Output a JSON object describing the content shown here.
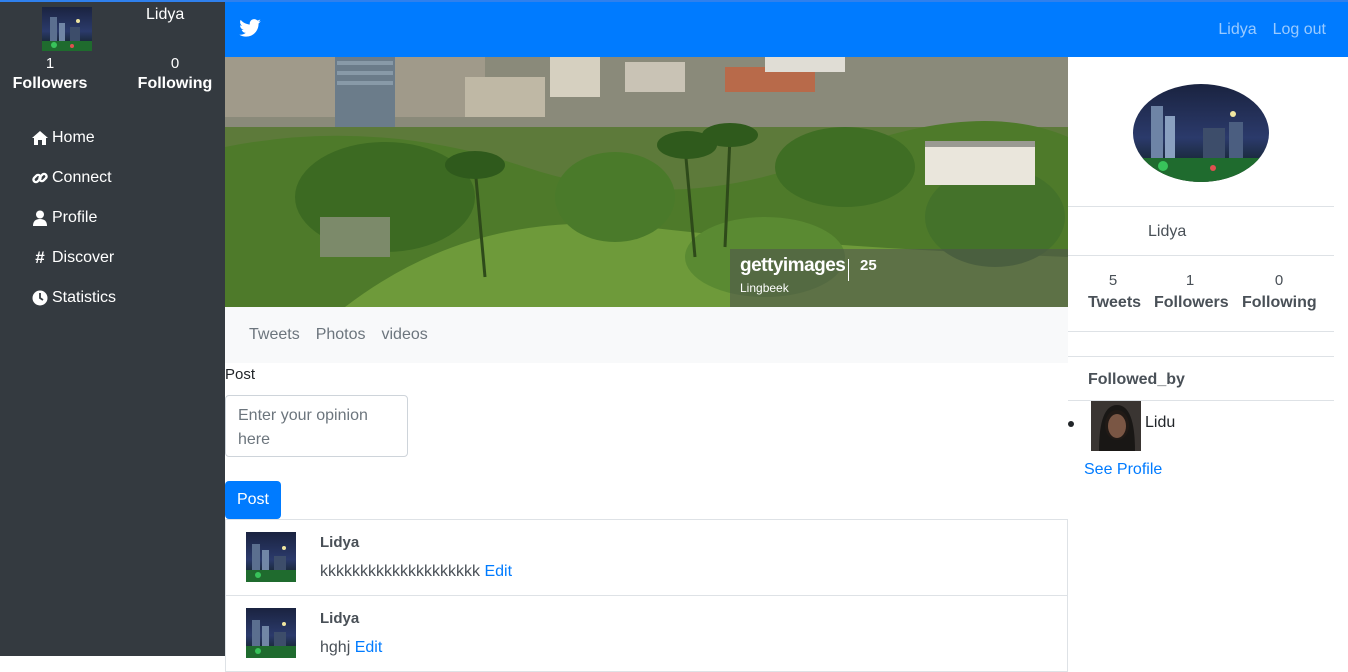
{
  "sidebar": {
    "username": "Lidya",
    "followers_count": "1",
    "followers_label": "Followers",
    "following_count": "0",
    "following_label": "Following",
    "nav": [
      {
        "label": "Home",
        "icon": "home-icon"
      },
      {
        "label": "Connect",
        "icon": "link-icon"
      },
      {
        "label": "Profile",
        "icon": "user-icon"
      },
      {
        "label": "Discover",
        "icon": "hashtag-icon"
      },
      {
        "label": "Statistics",
        "icon": "clock-icon"
      }
    ]
  },
  "topnav": {
    "brand_icon": "twitter-bird-icon",
    "user_link": "Lidya",
    "logout_link": "Log out"
  },
  "banner": {
    "watermark_brand": "gettyimages",
    "watermark_badge": "25",
    "watermark_credit": "Lingbeek"
  },
  "tabs": [
    "Tweets",
    "Photos",
    "videos"
  ],
  "post": {
    "label": "Post",
    "placeholder": "Enter your opinion here",
    "button": "Post"
  },
  "tweets": [
    {
      "name": "Lidya",
      "text": "kkkkkkkkkkkkkkkkkkkk",
      "edit": "Edit"
    },
    {
      "name": "Lidya",
      "text": "hghj",
      "edit": "Edit"
    }
  ],
  "profile": {
    "name": "Lidya",
    "stats": [
      {
        "value": "5",
        "label": "Tweets"
      },
      {
        "value": "1",
        "label": "Followers"
      },
      {
        "value": "0",
        "label": "Following"
      }
    ],
    "followed_by_title": "Followed_by",
    "followed_by": [
      {
        "name": "Lidu"
      }
    ],
    "see_profile": "See Profile"
  },
  "colors": {
    "primary": "#007bff",
    "sidebar": "#343a40",
    "tabs_bg": "#f8f9fa"
  }
}
